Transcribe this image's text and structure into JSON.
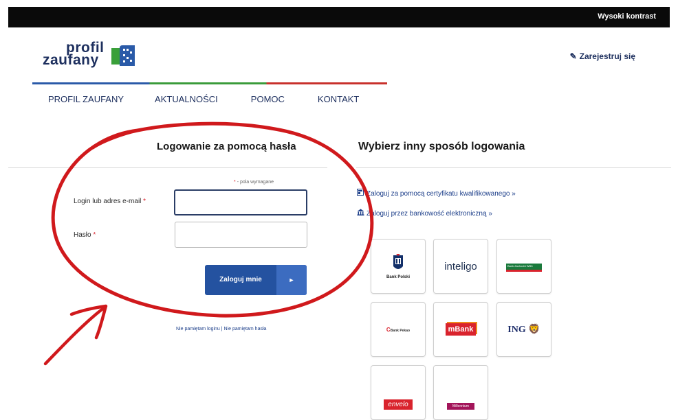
{
  "topbar": {
    "contrast_link": "Wysoki kontrast"
  },
  "logo": {
    "line1": "profil",
    "line2": "zaufany"
  },
  "header": {
    "register": "Zarejestruj się"
  },
  "nav": {
    "items": [
      "PROFIL ZAUFANY",
      "AKTUALNOŚCI",
      "POMOC",
      "KONTAKT"
    ]
  },
  "login": {
    "heading": "Logowanie za pomocą hasła",
    "required_note_star": "*",
    "required_note": "- pola wymagane",
    "login_label": "Login lub adres e-mail",
    "password_label": "Hasło",
    "required_star": "*",
    "login_value": "",
    "password_value": "",
    "submit_label": "Zaloguj mnie",
    "submit_arrow": "►",
    "forgot_login": "Nie pamiętam loginu",
    "forgot_separator": "|",
    "forgot_password": "Nie pamiętam hasła"
  },
  "alternatives": {
    "heading": "Wybierz inny sposób logowania",
    "certificate_link": "Zaloguj za pomocą certyfikatu kwalifikowanego »",
    "bank_link": "Zaloguj przez bankowość elektroniczną »"
  },
  "banks": [
    {
      "name": "Bank Polski",
      "icon": "pko-bank-polski-logo"
    },
    {
      "name": "inteligo",
      "icon": "inteligo-logo"
    },
    {
      "name": "Bank Zachodni WBK",
      "icon": "bzwbk-logo"
    },
    {
      "name": "Bank Pekao",
      "icon": "pekao-logo"
    },
    {
      "name": "mBank",
      "icon": "mbank-logo"
    },
    {
      "name": "ING",
      "icon": "ing-lion-logo"
    },
    {
      "name": "envelo",
      "icon": "envelo-logo"
    },
    {
      "name": "Millennium",
      "icon": "millennium-logo"
    }
  ],
  "colors": {
    "topbar": "#0a0a0a",
    "brand_navy": "#1d2f5e",
    "button": "#2452a0",
    "annotation_red": "#d0191c",
    "required_red": "#d9232d"
  }
}
